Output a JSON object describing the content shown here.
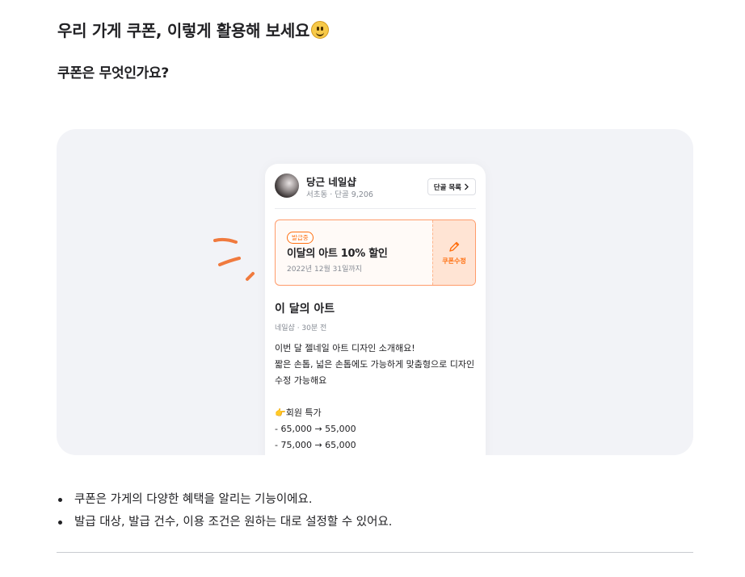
{
  "header": {
    "title": "우리 가게 쿠폰, 이렇게 활용해 보세요",
    "emoji_icon": "slightly-smiling-face",
    "subtitle": "쿠폰은 무엇인가요?"
  },
  "phone": {
    "shop": {
      "name": "당근 네일샵",
      "meta": "서초동 · 단골 9,206",
      "fans_button": "단골 목록"
    },
    "coupon": {
      "badge": "발급중",
      "title": "이달의 아트 10% 할인",
      "date": "2022년 12월 31일까지",
      "edit_label": "쿠폰수정"
    },
    "post": {
      "title": "이 달의 아트",
      "meta": "네일샵 · 30분 전",
      "line1": "이번 달 젤네일 아트 디자인 소개해요!",
      "line2": "짧은 손톱, 넓은 손톱에도 가능하게 맞춤형으로 디자인 수정 가능해요",
      "line3": "👉회원 특가",
      "line4": "- 65,000 → 55,000",
      "line5": "- 75,000 → 65,000"
    }
  },
  "bullets": [
    "쿠폰은 가게의 다양한 혜택을 알리는 기능이에요.",
    "발급 대상, 발급 건수, 이용 조건은 원하는 대로 설정할 수 있어요."
  ],
  "colors": {
    "accent": "#ff6f0f",
    "stage_bg": "#f2f3f7",
    "text": "#212124",
    "muted": "#868b94"
  }
}
